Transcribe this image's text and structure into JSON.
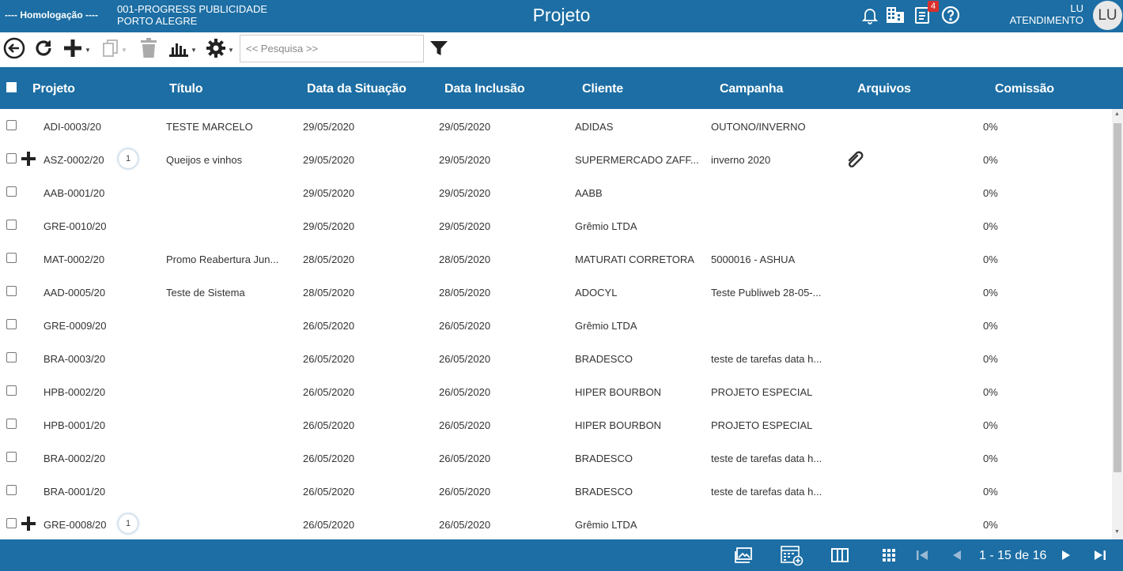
{
  "header": {
    "environment": "---- Homologação ----",
    "company_line1": "001-PROGRESS PUBLICIDADE",
    "company_line2": "PORTO ALEGRE",
    "title": "Projeto",
    "notifications_badge": "4",
    "user_name": "LU",
    "user_role": "ATENDIMENTO",
    "avatar_initials": "LU",
    "icons": [
      "bell-icon",
      "building-icon",
      "document-list-icon",
      "help-icon"
    ]
  },
  "toolbar": {
    "search_placeholder": "<< Pesquisa >>",
    "icons": [
      "back-icon",
      "refresh-icon",
      "add-icon",
      "copy-icon",
      "delete-icon",
      "chart-icon",
      "settings-icon",
      "filter-icon"
    ]
  },
  "table": {
    "columns": [
      "Projeto",
      "Título",
      "Data da Situação",
      "Data Inclusão",
      "Cliente",
      "Campanha",
      "Arquivos",
      "Comissão"
    ],
    "rows": [
      {
        "projeto": "ADI-0003/20",
        "titulo": "TESTE MARCELO",
        "data_situacao": "29/05/2020",
        "data_inclusao": "29/05/2020",
        "cliente": "ADIDAS",
        "campanha": "OUTONO/INVERNO",
        "comissao": "0%",
        "expand": false,
        "subcount": "",
        "attachment": false
      },
      {
        "projeto": "ASZ-0002/20",
        "titulo": "Queijos e vinhos",
        "data_situacao": "29/05/2020",
        "data_inclusao": "29/05/2020",
        "cliente": "SUPERMERCADO ZAFF...",
        "campanha": "inverno 2020",
        "comissao": "0%",
        "expand": true,
        "subcount": "1",
        "attachment": true
      },
      {
        "projeto": "AAB-0001/20",
        "titulo": "",
        "data_situacao": "29/05/2020",
        "data_inclusao": "29/05/2020",
        "cliente": "AABB",
        "campanha": "",
        "comissao": "0%",
        "expand": false,
        "subcount": "",
        "attachment": false
      },
      {
        "projeto": "GRE-0010/20",
        "titulo": "",
        "data_situacao": "29/05/2020",
        "data_inclusao": "29/05/2020",
        "cliente": "Grêmio LTDA",
        "campanha": "",
        "comissao": "0%",
        "expand": false,
        "subcount": "",
        "attachment": false
      },
      {
        "projeto": "MAT-0002/20",
        "titulo": "Promo Reabertura Jun...",
        "data_situacao": "28/05/2020",
        "data_inclusao": "28/05/2020",
        "cliente": "MATURATI CORRETORA",
        "campanha": "5000016 - ASHUA",
        "comissao": "0%",
        "expand": false,
        "subcount": "",
        "attachment": false
      },
      {
        "projeto": "AAD-0005/20",
        "titulo": "Teste de Sistema",
        "data_situacao": "28/05/2020",
        "data_inclusao": "28/05/2020",
        "cliente": "ADOCYL",
        "campanha": "Teste Publiweb 28-05-...",
        "comissao": "0%",
        "expand": false,
        "subcount": "",
        "attachment": false
      },
      {
        "projeto": "GRE-0009/20",
        "titulo": "",
        "data_situacao": "26/05/2020",
        "data_inclusao": "26/05/2020",
        "cliente": "Grêmio LTDA",
        "campanha": "",
        "comissao": "0%",
        "expand": false,
        "subcount": "",
        "attachment": false
      },
      {
        "projeto": "BRA-0003/20",
        "titulo": "",
        "data_situacao": "26/05/2020",
        "data_inclusao": "26/05/2020",
        "cliente": "BRADESCO",
        "campanha": "teste de tarefas data h...",
        "comissao": "0%",
        "expand": false,
        "subcount": "",
        "attachment": false
      },
      {
        "projeto": "HPB-0002/20",
        "titulo": "",
        "data_situacao": "26/05/2020",
        "data_inclusao": "26/05/2020",
        "cliente": "HIPER BOURBON",
        "campanha": "PROJETO ESPECIAL",
        "comissao": "0%",
        "expand": false,
        "subcount": "",
        "attachment": false
      },
      {
        "projeto": "HPB-0001/20",
        "titulo": "",
        "data_situacao": "26/05/2020",
        "data_inclusao": "26/05/2020",
        "cliente": "HIPER BOURBON",
        "campanha": "PROJETO ESPECIAL",
        "comissao": "0%",
        "expand": false,
        "subcount": "",
        "attachment": false
      },
      {
        "projeto": "BRA-0002/20",
        "titulo": "",
        "data_situacao": "26/05/2020",
        "data_inclusao": "26/05/2020",
        "cliente": "BRADESCO",
        "campanha": "teste de tarefas data h...",
        "comissao": "0%",
        "expand": false,
        "subcount": "",
        "attachment": false
      },
      {
        "projeto": "BRA-0001/20",
        "titulo": "",
        "data_situacao": "26/05/2020",
        "data_inclusao": "26/05/2020",
        "cliente": "BRADESCO",
        "campanha": "teste de tarefas data h...",
        "comissao": "0%",
        "expand": false,
        "subcount": "",
        "attachment": false
      },
      {
        "projeto": "GRE-0008/20",
        "titulo": "",
        "data_situacao": "26/05/2020",
        "data_inclusao": "26/05/2020",
        "cliente": "Grêmio LTDA",
        "campanha": "",
        "comissao": "0%",
        "expand": true,
        "subcount": "1",
        "attachment": false
      }
    ]
  },
  "footer": {
    "page_info": "1 - 15 de 16",
    "icons": [
      "gallery-view-icon",
      "calendar-view-icon",
      "columns-view-icon",
      "grid-view-icon",
      "first-page-icon",
      "previous-page-icon",
      "next-page-icon",
      "last-page-icon"
    ]
  },
  "colors": {
    "primary": "#1c6ea4",
    "badge": "#d9302c"
  }
}
